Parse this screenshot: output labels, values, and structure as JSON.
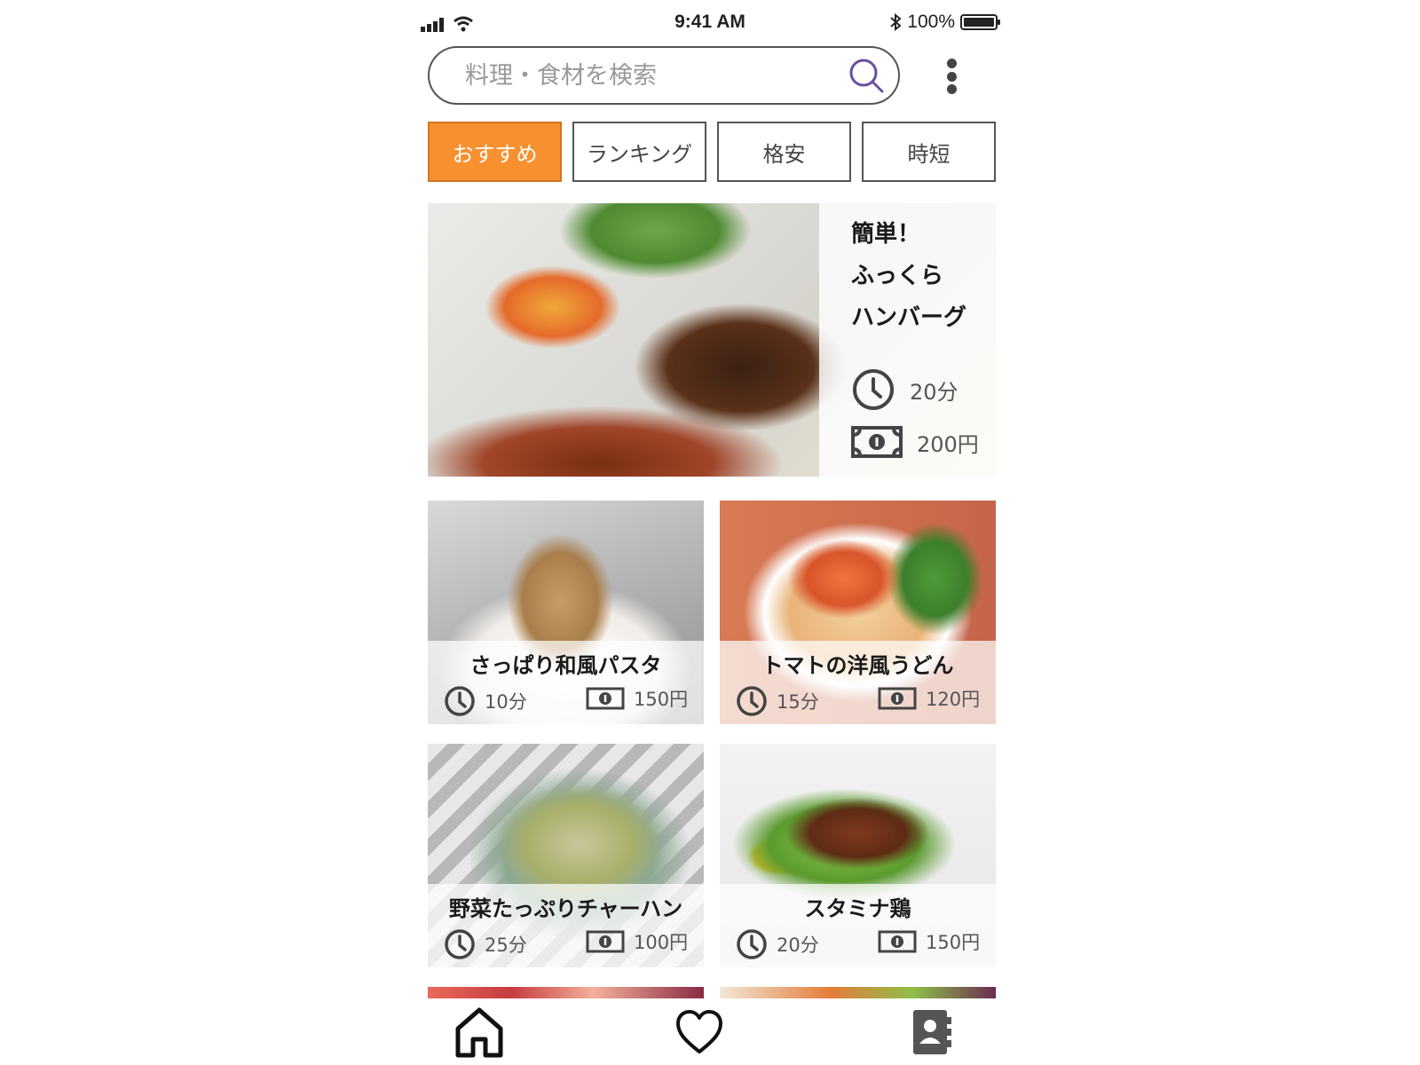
{
  "status_bar": {
    "time": "9:41 AM",
    "battery": "100%"
  },
  "search": {
    "placeholder": "料理・食材を検索"
  },
  "tabs": [
    {
      "label": "おすすめ",
      "active": true
    },
    {
      "label": "ランキング",
      "active": false
    },
    {
      "label": "格安",
      "active": false
    },
    {
      "label": "時短",
      "active": false
    }
  ],
  "featured": {
    "title_lines": [
      "簡単！",
      "ふっくら",
      "ハンバーグ"
    ],
    "time": "20分",
    "price": "200円"
  },
  "recipes": [
    {
      "name": "さっぱり和風パスタ",
      "time": "10分",
      "price": "150円"
    },
    {
      "name": "トマトの洋風うどん",
      "time": "15分",
      "price": "120円"
    },
    {
      "name": "野菜たっぷりチャーハン",
      "time": "25分",
      "price": "100円"
    },
    {
      "name": "スタミナ鶏",
      "time": "20分",
      "price": "150円"
    }
  ],
  "colors": {
    "accent": "#f7912f",
    "search_icon": "#6a4fa0"
  },
  "icons": {
    "status": [
      "signal-icon",
      "wifi-icon",
      "bluetooth-icon",
      "battery-icon"
    ],
    "search": "search-icon",
    "more": "more-vertical-icon",
    "meta": [
      "clock-icon",
      "money-icon"
    ],
    "bottom_nav": [
      "home-icon",
      "heart-icon",
      "contacts-icon"
    ]
  }
}
